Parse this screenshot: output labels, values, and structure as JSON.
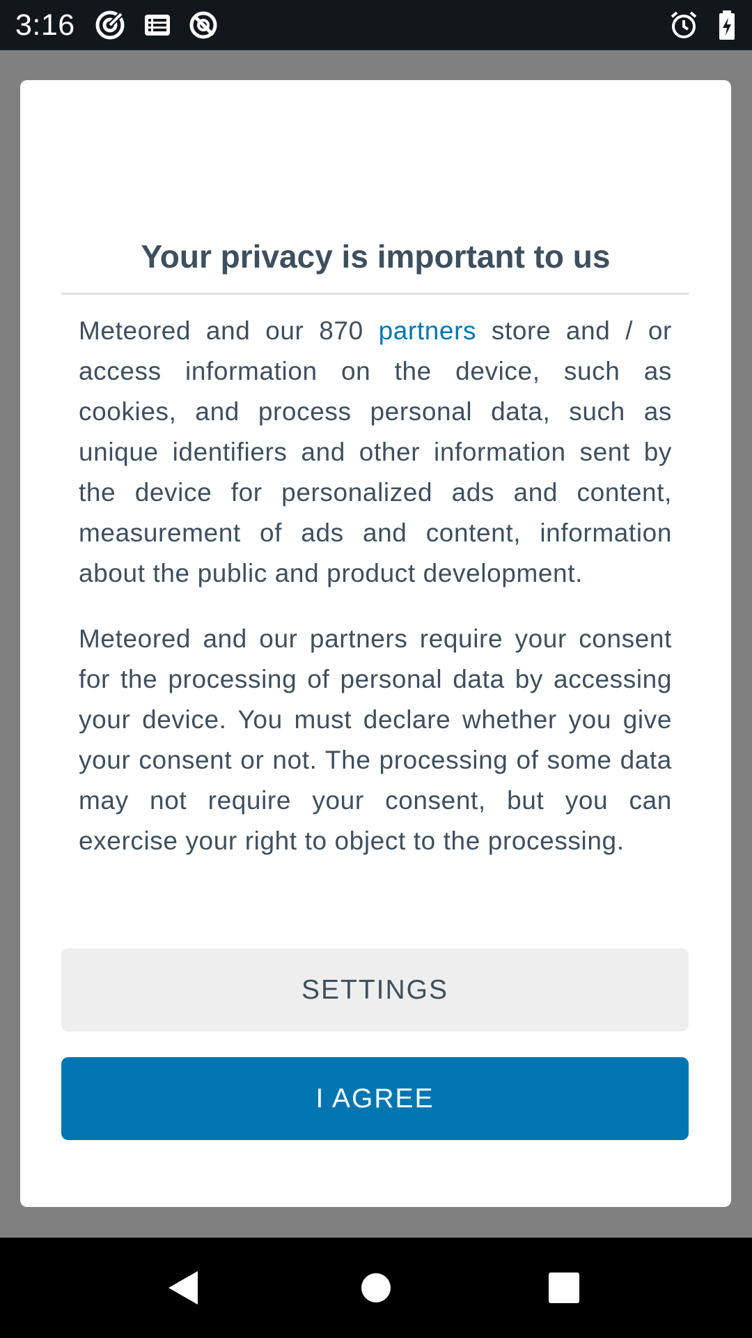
{
  "status_bar": {
    "time": "3:16",
    "left_icons": [
      "target-icon",
      "list-icon",
      "no-disturb-icon"
    ],
    "right_icons": [
      "alarm-icon",
      "battery-charging-icon"
    ]
  },
  "dialog": {
    "title": "Your privacy is important to us",
    "paragraph1": {
      "before_link": "Meteored and our 870 ",
      "link_text": "partners",
      "after_link": " store and / or access information on the device, such as cookies, and process personal data, such as unique identifiers and other information sent by the device for personalized ads and content, measurement of ads and content, information about the public and product development."
    },
    "paragraph2": "Meteored and our partners require your consent for the processing of personal data by accessing your device. You must declare whether you give your consent or not. The processing of some data may not require your consent, but you can exercise your right to object to the processing.",
    "settings_label": "SETTINGS",
    "agree_label": "I AGREE"
  },
  "nav_bar": {
    "buttons": [
      "back-icon",
      "home-icon",
      "recents-icon"
    ]
  },
  "colors": {
    "accent": "#0076b0",
    "text": "#3e4f5d",
    "scrim": "#808080",
    "status_bar": "#12171c"
  }
}
